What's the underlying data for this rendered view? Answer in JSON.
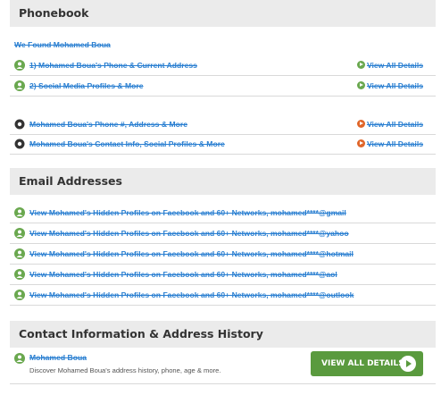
{
  "phonebook": {
    "title": "Phonebook",
    "found": "We Found Mohamed Boua",
    "rows": [
      {
        "text": "1) Mohamed Boua's Phone & Current Address",
        "action": "View All Details"
      },
      {
        "text": "2) Social Media Profiles & More",
        "action": "View All Details"
      },
      {
        "text": "Mohamed Boua's Phone #, Address & More",
        "action": "View All Details"
      },
      {
        "text": "Mohamed Boua's Contact Info, Social Profiles & More",
        "action": "View All Details"
      }
    ]
  },
  "email": {
    "title": "Email Addresses",
    "rows": [
      "View Mohamed's Hidden Profiles on Facebook and 60+ Networks, mohamed****@gmail",
      "View Mohamed's Hidden Profiles on Facebook and 60+ Networks, mohamed****@yahoo",
      "View Mohamed's Hidden Profiles on Facebook and 60+ Networks, mohamed****@hotmail",
      "View Mohamed's Hidden Profiles on Facebook and 60+ Networks, mohamed****@aol",
      "View Mohamed's Hidden Profiles on Facebook and 60+ Networks, mohamed****@outlook"
    ]
  },
  "contact": {
    "title": "Contact Information & Address History",
    "name": "Mohamed Boua",
    "description": "Discover Mohamed Boua's address history, phone, age & more.",
    "cta": "VIEW ALL DETAILS"
  },
  "colors": {
    "link": "#2a7fd1",
    "green": "#6aa84f",
    "orange": "#e0662a",
    "header_bg": "#ebebeb"
  },
  "icons": {
    "person": "person-icon",
    "phone": "phone-icon",
    "arrow": "arrow-circle-icon"
  }
}
